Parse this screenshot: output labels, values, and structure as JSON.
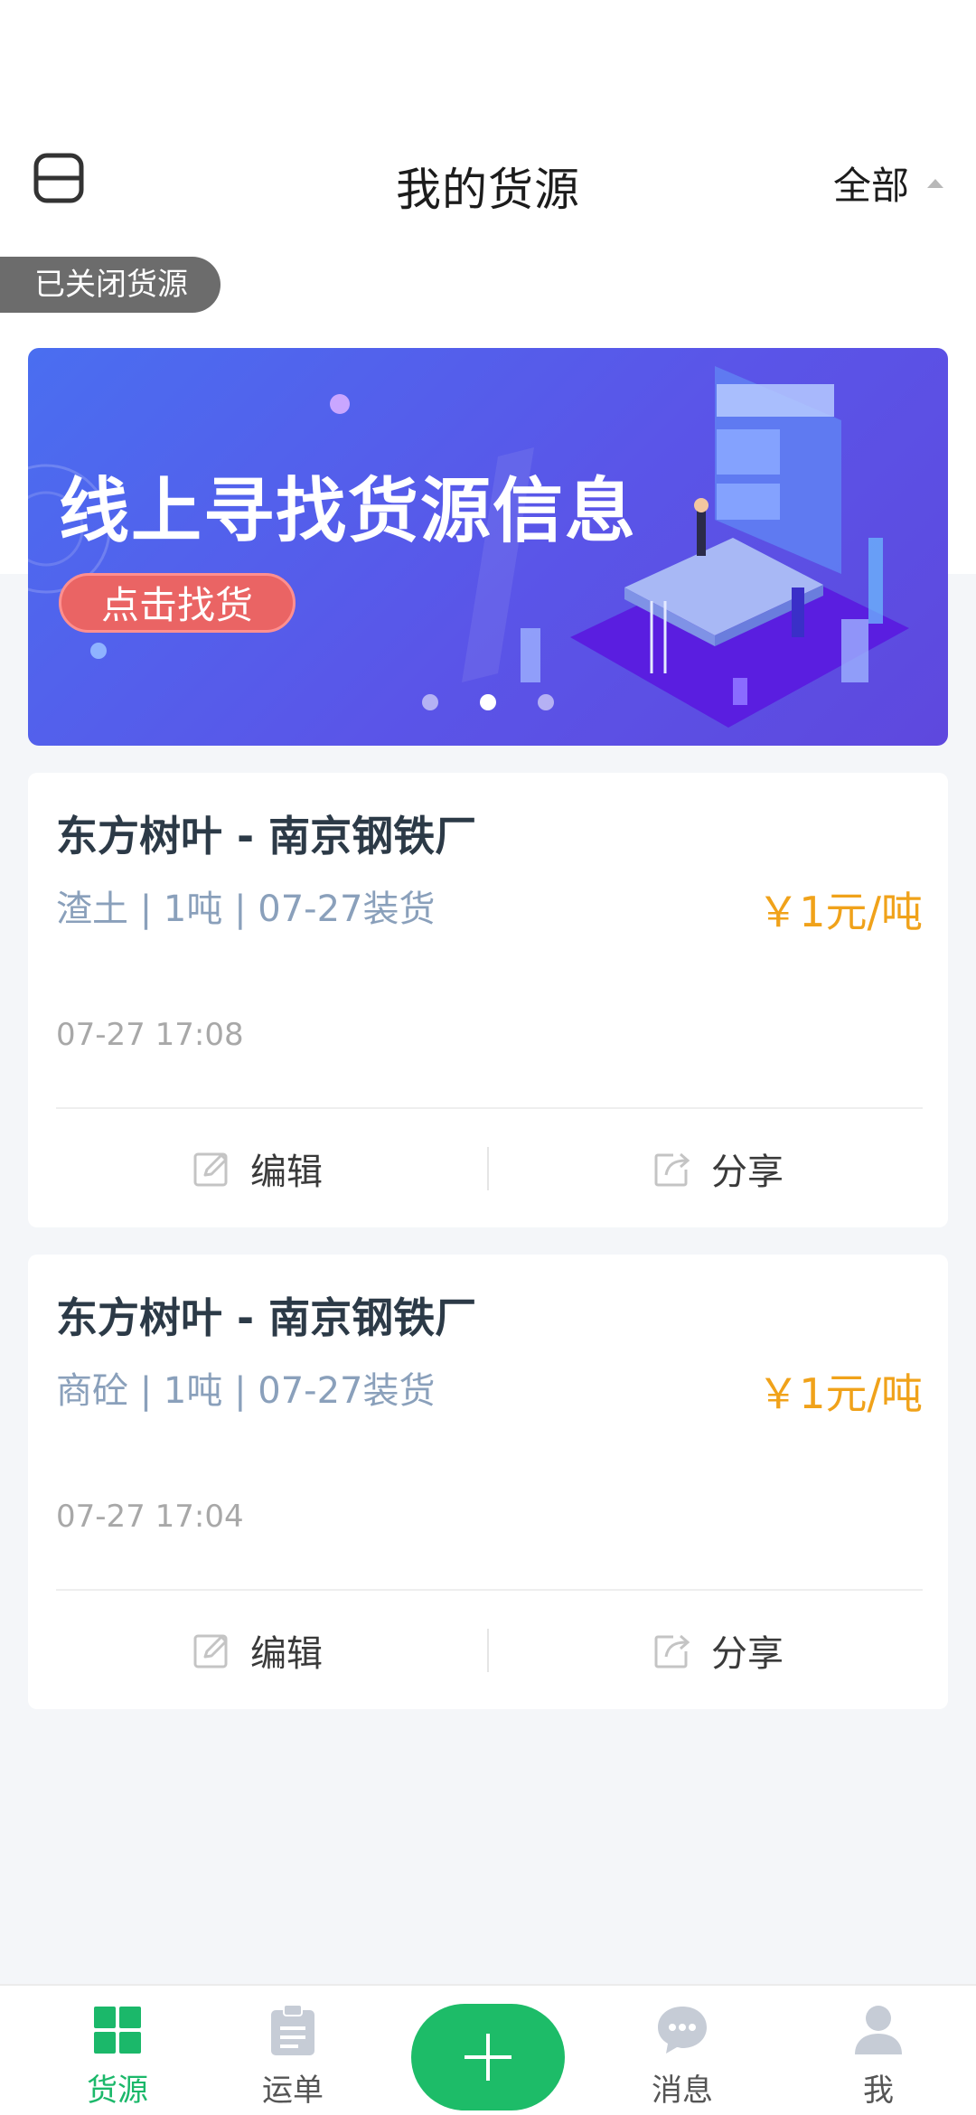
{
  "header": {
    "title": "我的货源",
    "filter_label": "全部"
  },
  "closed_sources_label": "已关闭货源",
  "banner": {
    "title": "线上寻找货源信息",
    "cta_label": "点击找货",
    "active_slide": 2,
    "slide_count": 3
  },
  "cards": [
    {
      "route": "东方树叶 - 南京钢铁厂",
      "meta": "渣土 | 1吨 | 07-27装货",
      "price": "￥1元/吨",
      "time": "07-27 17:08",
      "edit_label": "编辑",
      "share_label": "分享"
    },
    {
      "route": "东方树叶 - 南京钢铁厂",
      "meta": "商砼 | 1吨 | 07-27装货",
      "price": "￥1元/吨",
      "time": "07-27 17:04",
      "edit_label": "编辑",
      "share_label": "分享"
    }
  ],
  "nav": {
    "items": [
      {
        "label": "货源",
        "icon": "grid-icon",
        "active": true
      },
      {
        "label": "运单",
        "icon": "clipboard-icon"
      },
      {
        "label": "",
        "icon": "plus-icon"
      },
      {
        "label": "消息",
        "icon": "chat-bubble-icon"
      },
      {
        "label": "我",
        "icon": "person-icon"
      }
    ]
  },
  "colors": {
    "accent_green": "#1dbc68",
    "price_orange": "#f0a21a",
    "meta_blue_gray": "#8aa0bb",
    "banner_blue": "#5a55e8"
  }
}
